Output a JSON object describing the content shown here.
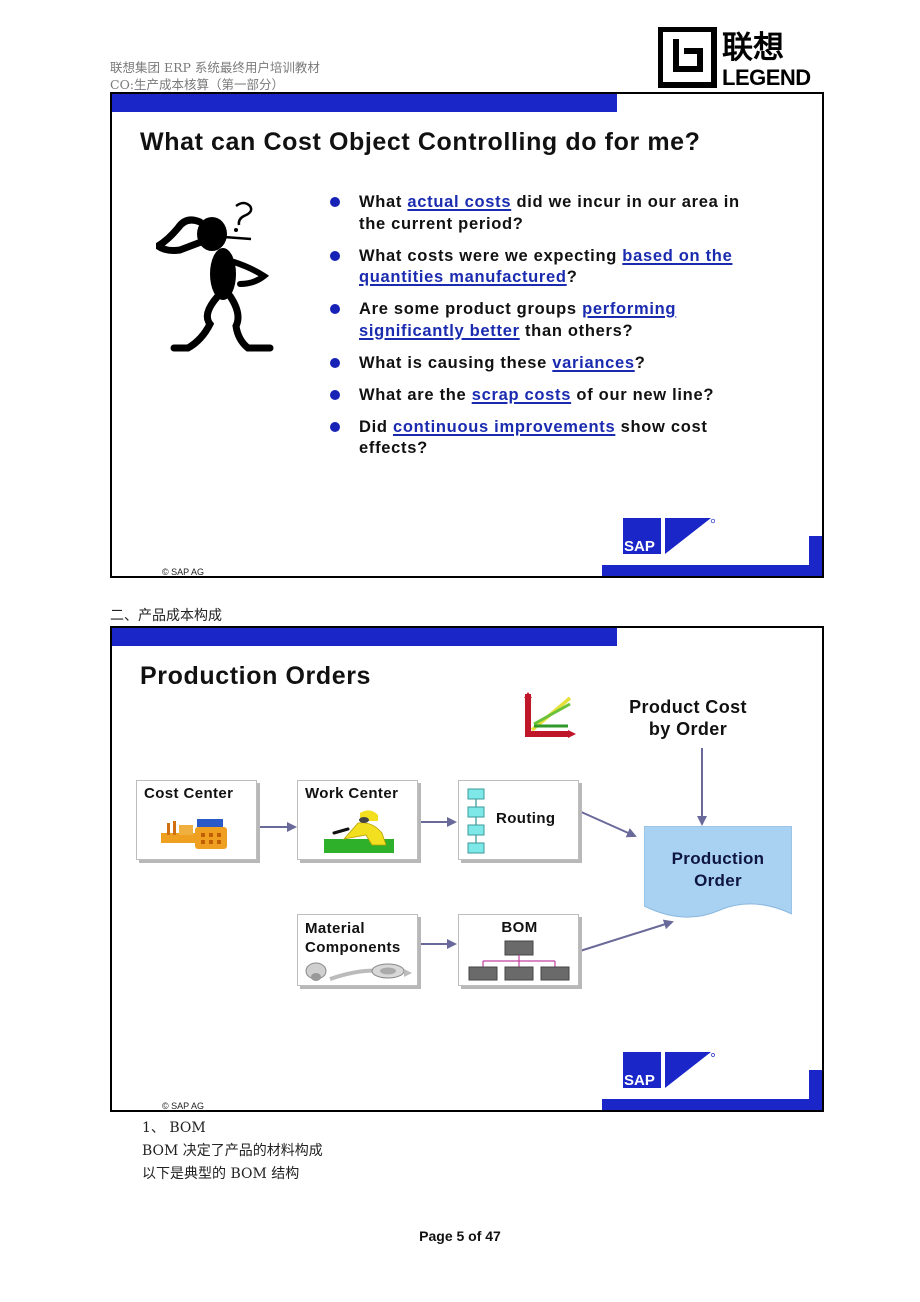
{
  "header": {
    "line1": "联想集团 ERP 系统最终用户培训教材",
    "line2": "CO:生产成本核算（第一部分）",
    "logo": {
      "brand_cn": "联想",
      "brand_en": "LEGEND"
    }
  },
  "slide1": {
    "title": "What can Cost Object Controlling do for me?",
    "illustration": "thinking-person-icon",
    "bullets": [
      {
        "pre": "What ",
        "highlight": "actual costs",
        "post": " did we incur in our area in the current period?"
      },
      {
        "pre": "What costs were we expecting ",
        "highlight": "based on the quantities manufactured",
        "post": "?"
      },
      {
        "pre": "Are some product groups ",
        "highlight": "performing significantly better",
        "post": " than others?"
      },
      {
        "pre": "What is causing these ",
        "highlight": "variances",
        "post": "?"
      },
      {
        "pre": "What are the ",
        "highlight": "scrap costs",
        "post": " of our new line?"
      },
      {
        "pre": "Did ",
        "highlight": "continuous improvements",
        "post": " show cost effects?"
      }
    ],
    "copyright": "©  SAP AG",
    "sap_logo": "SAP"
  },
  "section_heading": "二、产品成本构成",
  "slide2": {
    "title": "Production Orders",
    "product_cost_label_line1": "Product Cost",
    "product_cost_label_line2": "by Order",
    "boxes": {
      "cost_center": "Cost Center",
      "work_center": "Work Center",
      "routing": "Routing",
      "material_line1": "Material",
      "material_line2": "Components",
      "bom": "BOM"
    },
    "production_order_line1": "Production",
    "production_order_line2": "Order",
    "copyright": "©  SAP AG",
    "sap_logo": "SAP",
    "colors": {
      "accent_blue": "#1a26c8",
      "production_order_fill": "#a9d2f2",
      "arrow": "#6a6a9a"
    }
  },
  "body_text": {
    "item1": "1、 BOM",
    "line2": "BOM 决定了产品的材料构成",
    "line3": "以下是典型的 BOM 结构"
  },
  "footer": {
    "page_label": "Page 5 of  47"
  }
}
